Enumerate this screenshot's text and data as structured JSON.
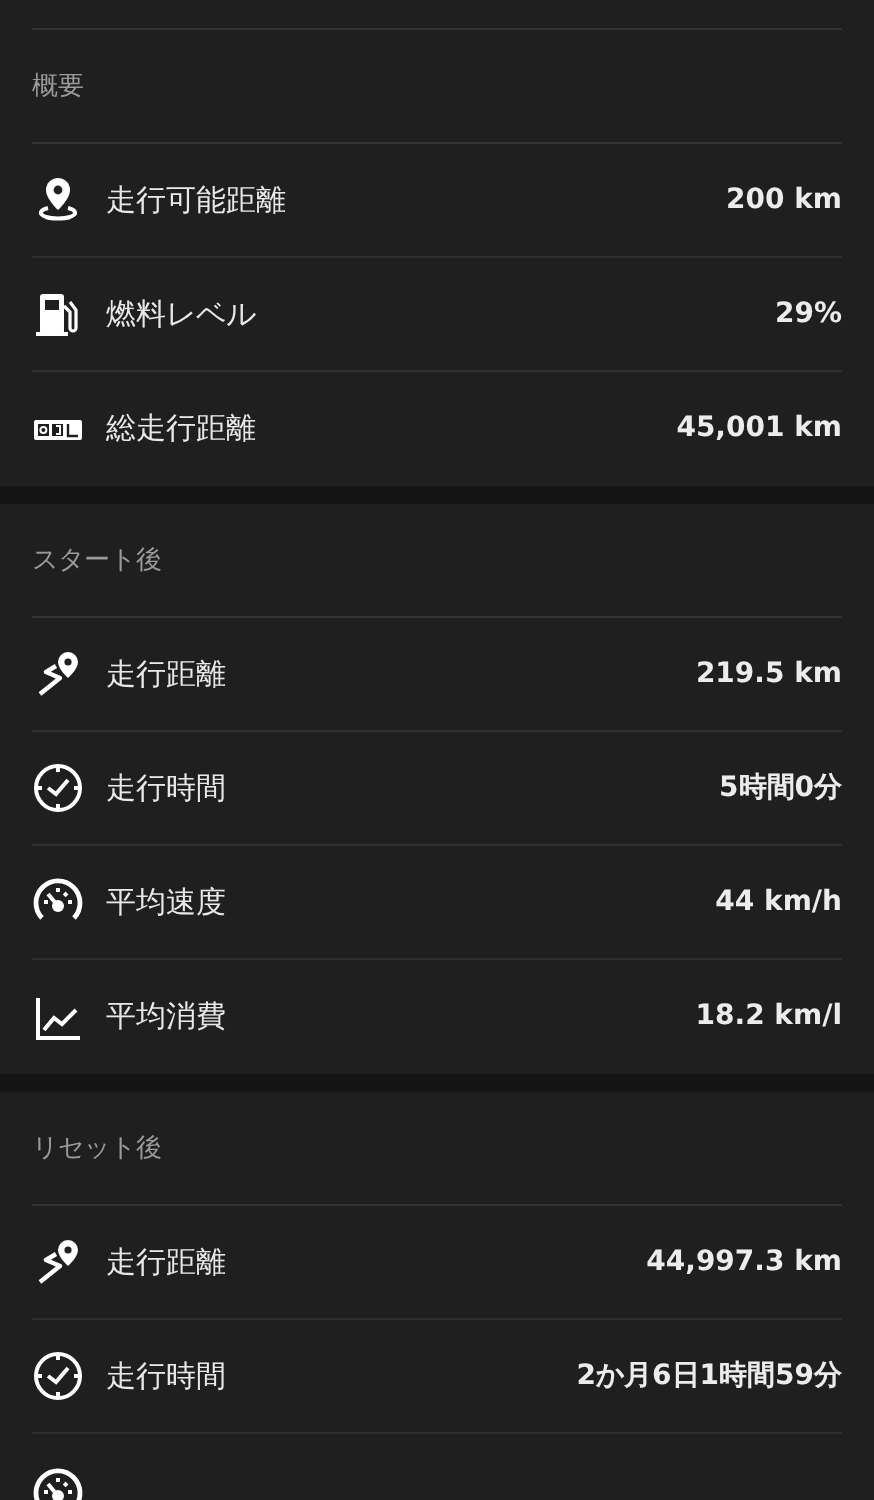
{
  "sections": [
    {
      "title": "概要",
      "rows": [
        {
          "kind": "pin",
          "label": "走行可能距離",
          "value": "200 km"
        },
        {
          "kind": "fuel",
          "label": "燃料レベル",
          "value": "29%"
        },
        {
          "kind": "odometer",
          "label": "総走行距離",
          "value": "45,001 km"
        }
      ]
    },
    {
      "title": "スタート後",
      "rows": [
        {
          "kind": "route",
          "label": "走行距離",
          "value": "219.5 km"
        },
        {
          "kind": "clock",
          "label": "走行時間",
          "value": "5時間0分"
        },
        {
          "kind": "speed",
          "label": "平均速度",
          "value": "44 km/h"
        },
        {
          "kind": "chart",
          "label": "平均消費",
          "value": "18.2 km/l"
        }
      ]
    },
    {
      "title": "リセット後",
      "rows": [
        {
          "kind": "route",
          "label": "走行距離",
          "value": "44,997.3 km"
        },
        {
          "kind": "clock",
          "label": "走行時間",
          "value": "2か月6日1時間59分"
        },
        {
          "kind": "speed"
        }
      ]
    }
  ]
}
